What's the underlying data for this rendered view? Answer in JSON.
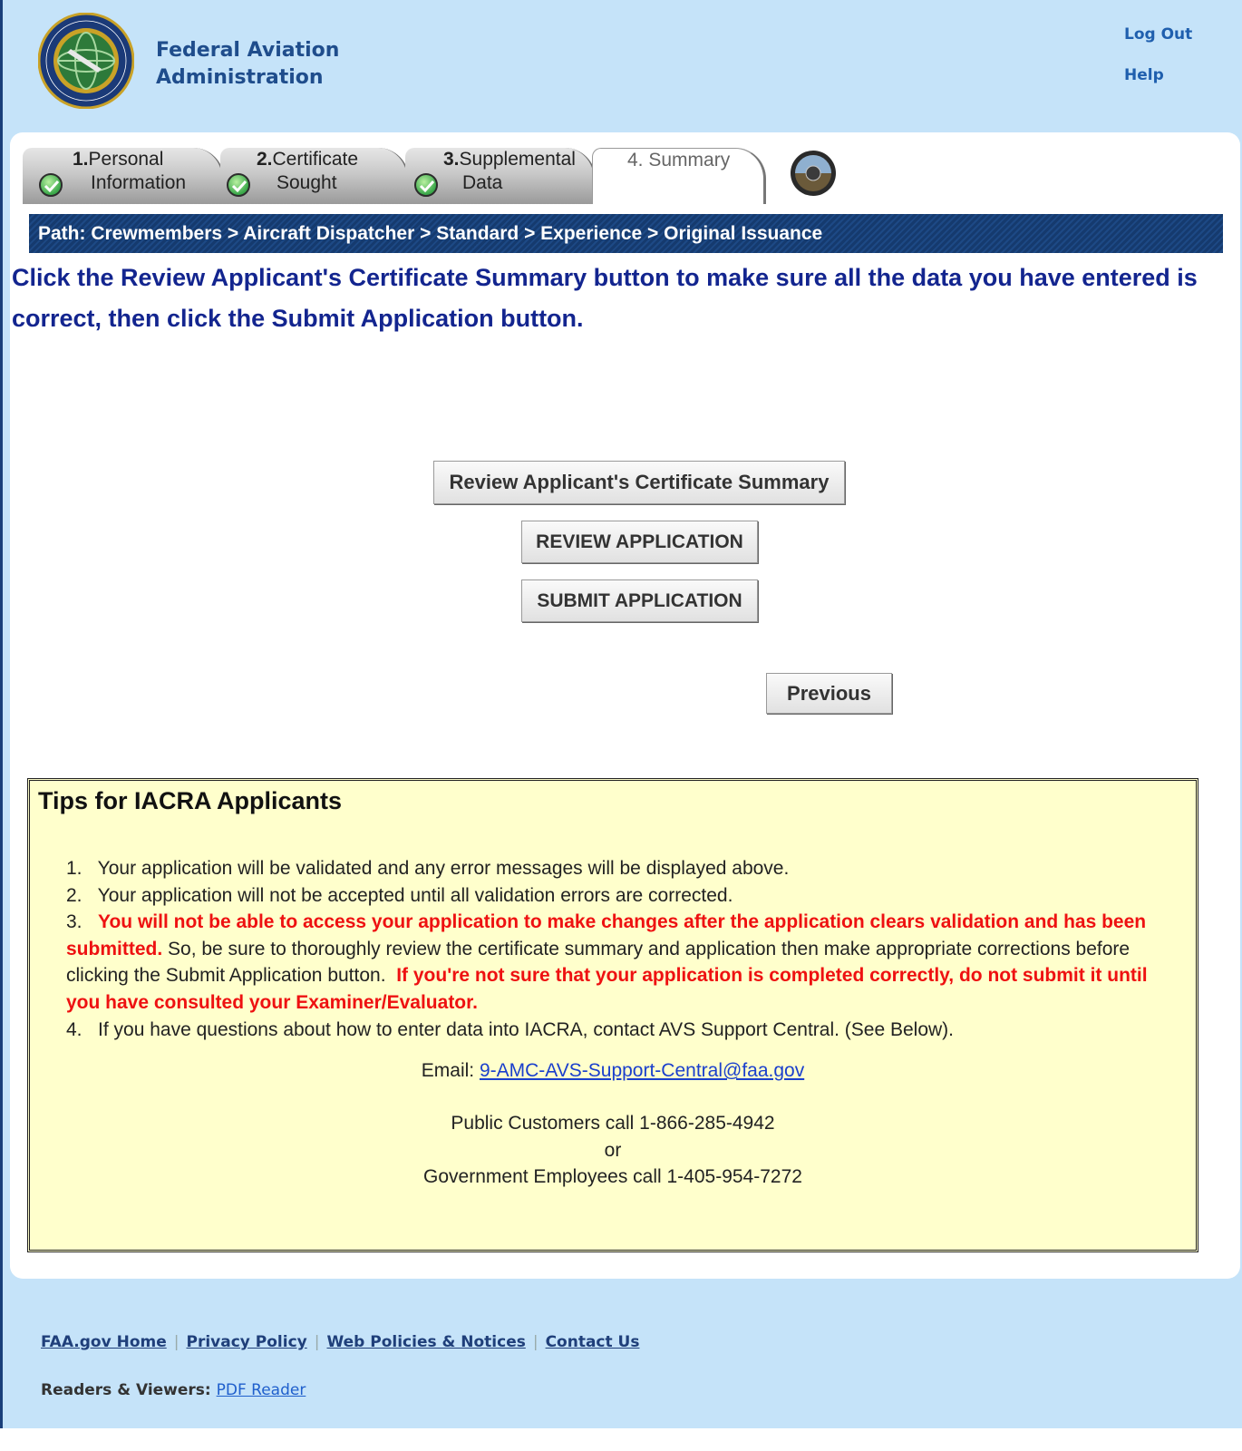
{
  "header": {
    "agency_line1": "Federal Aviation",
    "agency_line2": "Administration",
    "logout": "Log Out",
    "help": "Help",
    "seal_text": "FEDERAL AVIATION ADMINISTRATION"
  },
  "steps": [
    {
      "num": "1.",
      "line1": "Personal",
      "line2": "Information",
      "complete": true
    },
    {
      "num": "2.",
      "line1": "Certificate",
      "line2": "Sought",
      "complete": true
    },
    {
      "num": "3.",
      "line1": "Supplemental",
      "line2": "Data",
      "complete": true
    },
    {
      "num": "",
      "line1": "4. Summary",
      "line2": "",
      "complete": false
    }
  ],
  "path": "Path: Crewmembers > Aircraft Dispatcher > Standard > Experience > Original Issuance",
  "instruction": "Click the Review Applicant's Certificate Summary button to make sure all the data you have entered is correct, then click the Submit Application button.",
  "buttons": {
    "review_summary": "Review Applicant's Certificate Summary",
    "review_application": "REVIEW APPLICATION",
    "submit_application": "SUBMIT APPLICATION",
    "previous": "Previous"
  },
  "tips": {
    "title": "Tips for IACRA Applicants",
    "item1": "1.   Your application will be validated and any error messages will be displayed above.",
    "item2": "2.   Your application will not be accepted until all validation errors are corrected.",
    "item3_num": "3.",
    "item3_red1": "You will not be able to access your application to make changes after the application clears validation and has been submitted.",
    "item3_normal": " So, be sure to thoroughly review the certificate summary and application then make appropriate corrections before clicking the Submit Application button.",
    "item3_red2": "If you're not sure that your application is completed correctly, do not submit it until you have consulted your Examiner/Evaluator.",
    "item4": "4.   If you have questions about how to enter data into IACRA, contact AVS Support Central. (See Below).",
    "email_label": "Email: ",
    "email": "9-AMC-AVS-Support-Central@faa.gov",
    "public_call": "Public Customers call 1-866-285-4942",
    "or": "or",
    "gov_call": "Government Employees call 1-405-954-7272"
  },
  "footer": {
    "links": [
      "FAA.gov Home",
      "Privacy Policy",
      "Web Policies & Notices",
      "Contact Us"
    ],
    "sep": "|",
    "readers_label": "Readers & Viewers: ",
    "pdf_reader": "PDF Reader"
  },
  "colors": {
    "page_bg": "#c5e3f9",
    "path_bar": "#153a6e",
    "instruction": "#13258f",
    "tips_bg": "#ffffcc",
    "warning_red": "#ee1111"
  }
}
